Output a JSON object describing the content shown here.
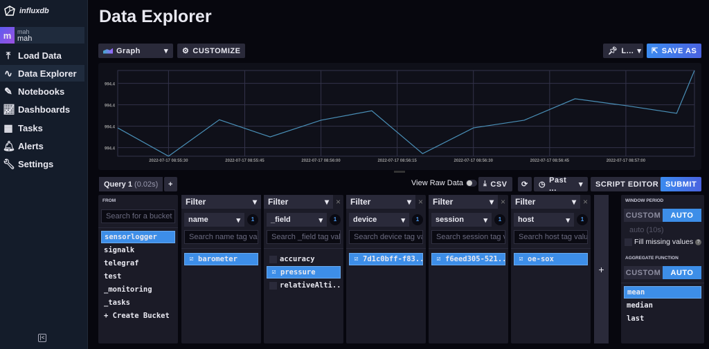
{
  "app": {
    "logo": "influxdb"
  },
  "user": {
    "initial": "m",
    "org": "mah",
    "name": "mah"
  },
  "nav": [
    {
      "label": "Load Data",
      "icon": "upload-icon"
    },
    {
      "label": "Data Explorer",
      "icon": "graph-icon",
      "active": true
    },
    {
      "label": "Notebooks",
      "icon": "notebook-icon"
    },
    {
      "label": "Dashboards",
      "icon": "dashboard-icon"
    },
    {
      "label": "Tasks",
      "icon": "calendar-icon"
    },
    {
      "label": "Alerts",
      "icon": "bell-icon"
    },
    {
      "label": "Settings",
      "icon": "wrench-icon"
    }
  ],
  "page": {
    "title": "Data Explorer"
  },
  "toolbar": {
    "graph_type": "Graph",
    "customize": "CUSTOMIZE",
    "pin": "L...",
    "save_as": "SAVE AS"
  },
  "query_bar": {
    "tab": "Query 1",
    "tab_time": "(0.02s)",
    "add": "+",
    "view_raw": "View Raw Data",
    "csv": "CSV",
    "time_range": "Past ...",
    "script_editor": "SCRIPT EDITOR",
    "submit": "SUBMIT"
  },
  "from": {
    "label": "FROM",
    "search_placeholder": "Search for a bucket",
    "buckets": [
      "sensorlogger",
      "signalk",
      "telegraf",
      "test",
      "_monitoring",
      "_tasks"
    ],
    "selected": "sensorlogger",
    "create": "+ Create Bucket"
  },
  "filters": [
    {
      "header": "Filter",
      "key": "name",
      "count": "1",
      "placeholder": "Search name tag values",
      "values": [
        {
          "v": "barometer",
          "checked": true
        }
      ],
      "closable": false
    },
    {
      "header": "Filter",
      "key": "_field",
      "count": "1",
      "placeholder": "Search _field tag values",
      "values": [
        {
          "v": "accuracy",
          "checked": false
        },
        {
          "v": "pressure",
          "checked": true
        },
        {
          "v": "relativeAlti...",
          "checked": false
        }
      ],
      "closable": true
    },
    {
      "header": "Filter",
      "key": "device",
      "count": "1",
      "placeholder": "Search device tag values",
      "values": [
        {
          "v": "7d1c0bff-f83...",
          "checked": true
        }
      ],
      "closable": true
    },
    {
      "header": "Filter",
      "key": "session",
      "count": "1",
      "placeholder": "Search session tag values",
      "values": [
        {
          "v": "f6eed305-521...",
          "checked": true
        }
      ],
      "closable": true
    },
    {
      "header": "Filter",
      "key": "host",
      "count": "1",
      "placeholder": "Search host tag values",
      "values": [
        {
          "v": "oe-sox",
          "checked": true
        }
      ],
      "closable": true
    }
  ],
  "add_filter": "+",
  "window": {
    "label": "WINDOW PERIOD",
    "custom": "CUSTOM",
    "auto": "AUTO",
    "auto_value": "auto (10s)",
    "fill_missing": "Fill missing values"
  },
  "aggregate": {
    "label": "AGGREGATE FUNCTION",
    "custom": "CUSTOM",
    "auto": "AUTO",
    "functions": [
      "mean",
      "median",
      "last"
    ],
    "selected": "mean"
  },
  "colors": {
    "accent": "#3d8ee8",
    "line": "#4a90b8"
  },
  "chart_data": {
    "type": "line",
    "x_unit": "seconds after 2022-07-17 08:55:00",
    "x": [
      20,
      30,
      40,
      50,
      60,
      70,
      80,
      90,
      100,
      110,
      120,
      130,
      133.5
    ],
    "y": [
      994.366,
      994.3,
      994.385,
      994.345,
      994.384,
      994.406,
      994.306,
      994.366,
      994.384,
      994.434,
      994.418,
      994.4,
      994.5
    ],
    "xlim": [
      20,
      133.5
    ],
    "ylim": [
      994.3,
      994.5
    ],
    "y_ticks": [
      994.32,
      994.37,
      994.42,
      994.47
    ],
    "y_tick_labels": [
      "994.4",
      "994.4",
      "994.4",
      "994.4"
    ],
    "x_ticks": [
      30,
      45,
      60,
      75,
      90,
      105,
      120
    ],
    "x_tick_labels": [
      "2022-07-17 08:55:30",
      "2022-07-17 08:55:45",
      "2022-07-17 08:56:00",
      "2022-07-17 08:56:15",
      "2022-07-17 08:56:30",
      "2022-07-17 08:56:45",
      "2022-07-17 08:57:00"
    ],
    "grid": true,
    "legend": "none"
  }
}
